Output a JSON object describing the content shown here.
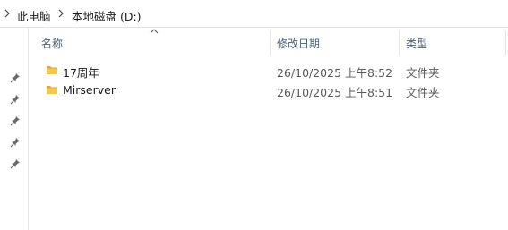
{
  "breadcrumb": {
    "root": "此电脑",
    "drive": "本地磁盘 (D:)"
  },
  "columns": {
    "name": "名称",
    "modified": "修改日期",
    "type": "类型"
  },
  "files": [
    {
      "name": "17周年",
      "modified": "26/10/2025 上午8:52",
      "type": "文件夹"
    },
    {
      "name": "Mirserver",
      "modified": "26/10/2025 上午8:51",
      "type": "文件夹"
    }
  ],
  "colors": {
    "header_text": "#4c607a",
    "folder": "#f3c852",
    "folder_dark": "#dca83a"
  },
  "icons": [
    "chevron-right-icon",
    "pin-icon",
    "folder-icon",
    "sort-up-icon"
  ]
}
